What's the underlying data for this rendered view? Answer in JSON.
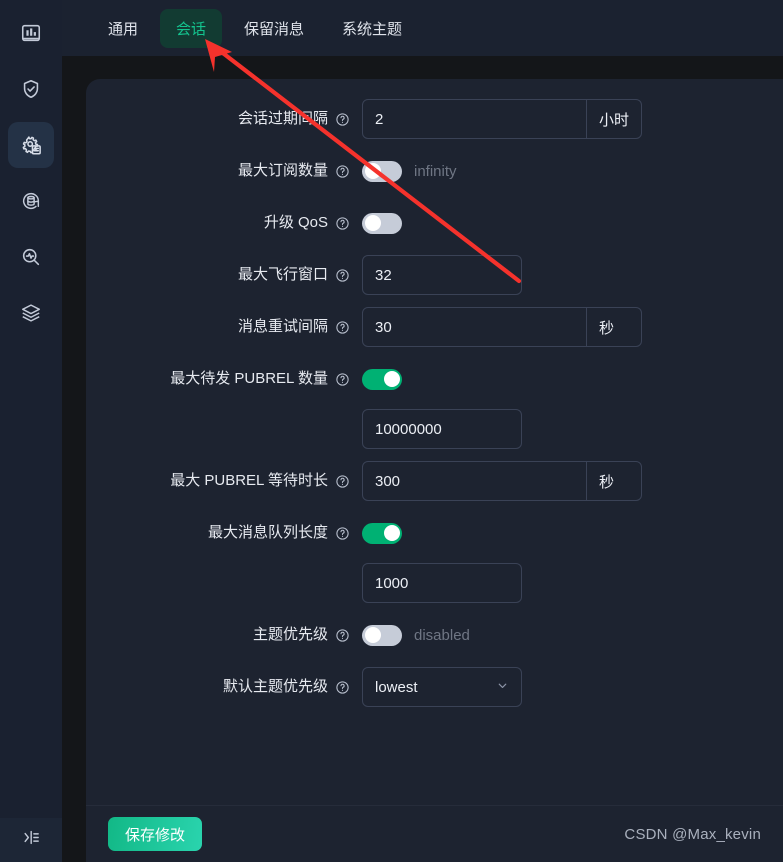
{
  "sidebar": {
    "items": [
      {
        "name": "dashboard-icon",
        "icon": "chart-bar"
      },
      {
        "name": "access-control-icon",
        "icon": "shield-check"
      },
      {
        "name": "configuration-icon",
        "icon": "gear-document",
        "active": true
      },
      {
        "name": "data-integration-icon",
        "icon": "database-sync"
      },
      {
        "name": "diagnose-icon",
        "icon": "magnifier-pulse"
      },
      {
        "name": "extensions-icon",
        "icon": "layers"
      }
    ],
    "collapse_label": "collapse-panel-icon"
  },
  "tabs": [
    {
      "label": "通用",
      "active": false
    },
    {
      "label": "会话",
      "active": true
    },
    {
      "label": "保留消息",
      "active": false
    },
    {
      "label": "系统主题",
      "active": false
    }
  ],
  "form": {
    "rows": [
      {
        "label": "会话过期间隔",
        "type": "input-unit",
        "value": "2",
        "unit": "小时"
      },
      {
        "label": "最大订阅数量",
        "type": "switch",
        "on": false,
        "state_text": "infinity"
      },
      {
        "label": "升级 QoS",
        "type": "switch",
        "on": false,
        "state_text": ""
      },
      {
        "label": "最大飞行窗口",
        "type": "input",
        "value": "32"
      },
      {
        "label": "消息重试间隔",
        "type": "input-unit",
        "value": "30",
        "unit": "秒"
      },
      {
        "label": "最大待发 PUBREL 数量",
        "type": "switch-input",
        "on": true,
        "value": "10000000"
      },
      {
        "label": "最大 PUBREL 等待时长",
        "type": "input-unit",
        "value": "300",
        "unit": "秒"
      },
      {
        "label": "最大消息队列长度",
        "type": "switch-input",
        "on": true,
        "value": "1000"
      },
      {
        "label": "主题优先级",
        "type": "switch",
        "on": false,
        "state_text": "disabled"
      },
      {
        "label": "默认主题优先级",
        "type": "select",
        "value": "lowest"
      }
    ]
  },
  "footer": {
    "save_label": "保存修改",
    "watermark": "CSDN @Max_kevin"
  },
  "colors": {
    "accent_green": "#14c38e",
    "switch_on": "#00b173",
    "switch_off": "#c6ccd8",
    "sidebar_bg": "#1a2130",
    "card_bg": "#1d2330",
    "page_bg": "#141619",
    "annotation_red": "#f5322c"
  }
}
